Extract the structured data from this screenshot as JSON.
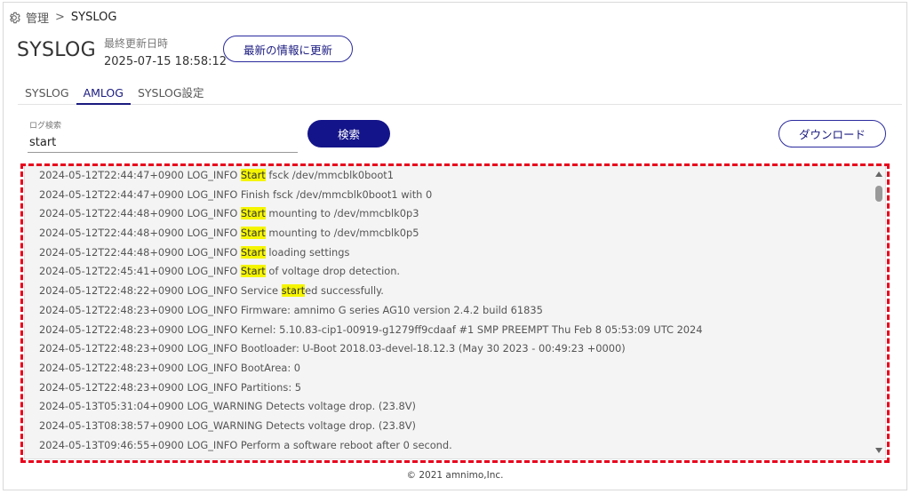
{
  "breadcrumb": {
    "root": "管理",
    "separator": ">",
    "current": "SYSLOG"
  },
  "header": {
    "title": "SYSLOG",
    "updated_label": "最終更新日時",
    "updated_value": "2025-07-15 18:58:12",
    "refresh_label": "最新の情報に更新"
  },
  "tabs": [
    {
      "label": "SYSLOG",
      "active": false
    },
    {
      "label": "AMLOG",
      "active": true
    },
    {
      "label": "SYSLOG設定",
      "active": false
    }
  ],
  "search": {
    "label": "ログ検索",
    "value": "start",
    "button_label": "検索"
  },
  "download_label": "ダウンロード",
  "log": {
    "lines": [
      {
        "pre": "2024-05-12T22:44:47+0900 LOG_INFO ",
        "hl": "Start",
        "post": " fsck /dev/mmcblk0boot1"
      },
      {
        "pre": "2024-05-12T22:44:47+0900 LOG_INFO Finish fsck /dev/mmcblk0boot1 with 0",
        "hl": "",
        "post": ""
      },
      {
        "pre": "2024-05-12T22:44:48+0900 LOG_INFO ",
        "hl": "Start",
        "post": " mounting to /dev/mmcblk0p3"
      },
      {
        "pre": "2024-05-12T22:44:48+0900 LOG_INFO ",
        "hl": "Start",
        "post": " mounting to /dev/mmcblk0p5"
      },
      {
        "pre": "2024-05-12T22:44:48+0900 LOG_INFO ",
        "hl": "Start",
        "post": " loading settings"
      },
      {
        "pre": "2024-05-12T22:45:41+0900 LOG_INFO ",
        "hl": "Start",
        "post": " of voltage drop detection."
      },
      {
        "pre": "2024-05-12T22:48:22+0900 LOG_INFO Service ",
        "hl": "start",
        "post": "ed successfully."
      },
      {
        "pre": "2024-05-12T22:48:23+0900 LOG_INFO Firmware: amnimo G series AG10 version 2.4.2 build 61835",
        "hl": "",
        "post": ""
      },
      {
        "pre": "2024-05-12T22:48:23+0900 LOG_INFO Kernel: 5.10.83-cip1-00919-g1279ff9cdaaf #1 SMP PREEMPT Thu Feb 8 05:53:09 UTC 2024",
        "hl": "",
        "post": ""
      },
      {
        "pre": "2024-05-12T22:48:23+0900 LOG_INFO Bootloader: U-Boot 2018.03-devel-18.12.3 (May 30 2023 - 00:49:23 +0000)",
        "hl": "",
        "post": ""
      },
      {
        "pre": "2024-05-12T22:48:23+0900 LOG_INFO BootArea: 0",
        "hl": "",
        "post": ""
      },
      {
        "pre": "2024-05-12T22:48:23+0900 LOG_INFO Partitions: 5",
        "hl": "",
        "post": ""
      },
      {
        "pre": "2024-05-13T05:31:04+0900 LOG_WARNING Detects voltage drop. (23.8V)",
        "hl": "",
        "post": ""
      },
      {
        "pre": "2024-05-13T08:38:57+0900 LOG_WARNING Detects voltage drop. (23.8V)",
        "hl": "",
        "post": ""
      },
      {
        "pre": "2024-05-13T09:46:55+0900 LOG_INFO Perform a software reboot after 0 second.",
        "hl": "",
        "post": ""
      }
    ]
  },
  "footer": "© 2021 amnimo,Inc.",
  "colors": {
    "accent": "#14148a",
    "highlight": "#f5f500",
    "annotation": "#e8001c"
  },
  "icons": {
    "breadcrumb": "gear-icon",
    "scroll_up": "arrow-up-icon",
    "scroll_down": "arrow-down-icon"
  }
}
